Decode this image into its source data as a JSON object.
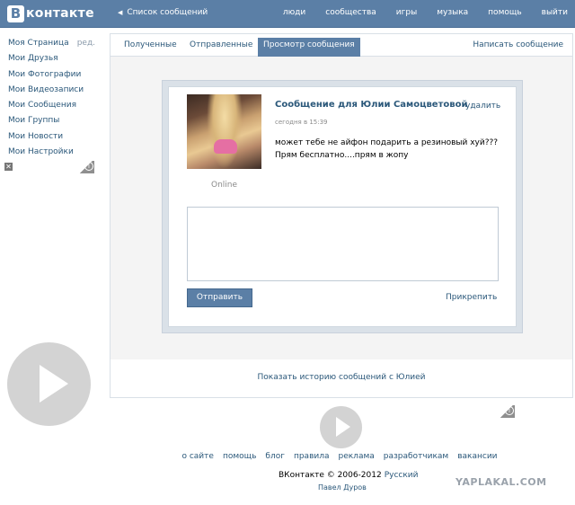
{
  "header": {
    "logo_letter": "В",
    "logo_word": "контакте",
    "back_label": "Список сообщений",
    "nav": [
      "люди",
      "сообщества",
      "игры",
      "музыка",
      "помощь",
      "выйти"
    ]
  },
  "left_menu": {
    "items": [
      "Моя Страница",
      "Мои Друзья",
      "Мои Фотографии",
      "Мои Видеозаписи",
      "Мои Сообщения",
      "Мои Группы",
      "Мои Новости",
      "Мои Настройки"
    ],
    "edit_label": "ред."
  },
  "ad": {
    "close_glyph": "✕",
    "info_glyph": "i"
  },
  "tabs": {
    "items": [
      "Полученные",
      "Отправленные",
      "Просмотр сообщения"
    ],
    "active_index": 2,
    "write_label": "Написать сообщение"
  },
  "message": {
    "title": "Сообщение для Юлии Самоцветовой",
    "delete_label": "удалить",
    "date": "сегодня в 15:39",
    "text_line1": "может тебе не айфон подарить а резиновый хуй???",
    "text_line2": "Прям бесплатно....прям в жопу",
    "status": "Online",
    "send_label": "Отправить",
    "attach_label": "Прикрепить",
    "history_label": "Показать историю сообщений с Юлией"
  },
  "footer": {
    "links": [
      "о сайте",
      "помощь",
      "блог",
      "правила",
      "реклама",
      "разработчикам",
      "вакансии"
    ],
    "copyright": "ВКонтакте © 2006-2012",
    "language": "Русский",
    "author": "Павел Дуров"
  },
  "watermark": "YAPLAKAL.COM",
  "colors": {
    "header_bg": "#5b7fa6",
    "link": "#2B587A",
    "panel_gray": "#f4f4f4",
    "message_frame": "#dae1e8"
  }
}
